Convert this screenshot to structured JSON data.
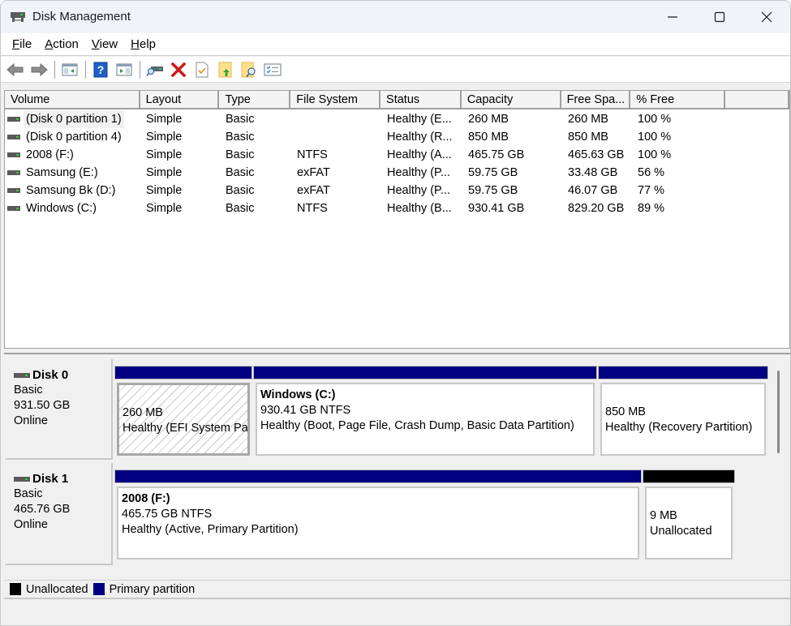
{
  "window": {
    "title": "Disk Management",
    "controls": {
      "minimize": "minimize",
      "maximize": "maximize",
      "close": "close"
    }
  },
  "menu": [
    {
      "label": "File",
      "accel": "F",
      "rest": "ile"
    },
    {
      "label": "Action",
      "accel": "A",
      "rest": "ction"
    },
    {
      "label": "View",
      "accel": "V",
      "rest": "iew"
    },
    {
      "label": "Help",
      "accel": "H",
      "rest": "elp"
    }
  ],
  "toolbar": {
    "buttons": [
      "back-icon",
      "forward-icon",
      "show-hide-console-tree-icon",
      "help-icon",
      "show-hide-action-pane-icon",
      "connect-drive-icon",
      "delete-icon",
      "properties-icon",
      "open-icon",
      "explore-icon",
      "settings-list-icon"
    ]
  },
  "volume_list": {
    "columns": [
      "Volume",
      "Layout",
      "Type",
      "File System",
      "Status",
      "Capacity",
      "Free Spa...",
      "% Free"
    ],
    "rows": [
      {
        "volume": "(Disk 0 partition 1)",
        "layout": "Simple",
        "type": "Basic",
        "fs": "",
        "status": "Healthy (E...",
        "capacity": "260 MB",
        "free": "260 MB",
        "pct": "100 %",
        "selected": true
      },
      {
        "volume": "(Disk 0 partition 4)",
        "layout": "Simple",
        "type": "Basic",
        "fs": "",
        "status": "Healthy (R...",
        "capacity": "850 MB",
        "free": "850 MB",
        "pct": "100 %"
      },
      {
        "volume": "2008 (F:)",
        "layout": "Simple",
        "type": "Basic",
        "fs": "NTFS",
        "status": "Healthy (A...",
        "capacity": "465.75 GB",
        "free": "465.63 GB",
        "pct": "100 %"
      },
      {
        "volume": "Samsung (E:)",
        "layout": "Simple",
        "type": "Basic",
        "fs": "exFAT",
        "status": "Healthy (P...",
        "capacity": "59.75 GB",
        "free": "33.48 GB",
        "pct": "56 %"
      },
      {
        "volume": "Samsung Bk (D:)",
        "layout": "Simple",
        "type": "Basic",
        "fs": "exFAT",
        "status": "Healthy (P...",
        "capacity": "59.75 GB",
        "free": "46.07 GB",
        "pct": "77 %"
      },
      {
        "volume": "Windows (C:)",
        "layout": "Simple",
        "type": "Basic",
        "fs": "NTFS",
        "status": "Healthy (B...",
        "capacity": "930.41 GB",
        "free": "829.20 GB",
        "pct": "89 %"
      }
    ]
  },
  "disks": [
    {
      "name": "Disk 0",
      "kind": "Basic",
      "size": "931.50 GB",
      "state": "Online",
      "partitions": [
        {
          "title": "",
          "line1": "260 MB",
          "line2": "Healthy (EFI System Pa",
          "kind": "primary",
          "hatched": true
        },
        {
          "title": "Windows  (C:)",
          "line1": "930.41 GB NTFS",
          "line2": "Healthy (Boot, Page File, Crash Dump, Basic Data Partition)",
          "kind": "primary"
        },
        {
          "title": "",
          "line1": "850 MB",
          "line2": "Healthy (Recovery Partition)",
          "kind": "primary"
        }
      ]
    },
    {
      "name": "Disk 1",
      "kind": "Basic",
      "size": "465.76 GB",
      "state": "Online",
      "partitions": [
        {
          "title": "2008  (F:)",
          "line1": "465.75 GB NTFS",
          "line2": "Healthy (Active, Primary Partition)",
          "kind": "primary"
        },
        {
          "title": "",
          "line1": "9 MB",
          "line2": "Unallocated",
          "kind": "unallocated"
        }
      ]
    }
  ],
  "legend": [
    {
      "label": "Unallocated",
      "color": "#000000"
    },
    {
      "label": "Primary partition",
      "color": "#000080"
    }
  ],
  "colors": {
    "primary": "#000080",
    "unallocated": "#000000"
  }
}
